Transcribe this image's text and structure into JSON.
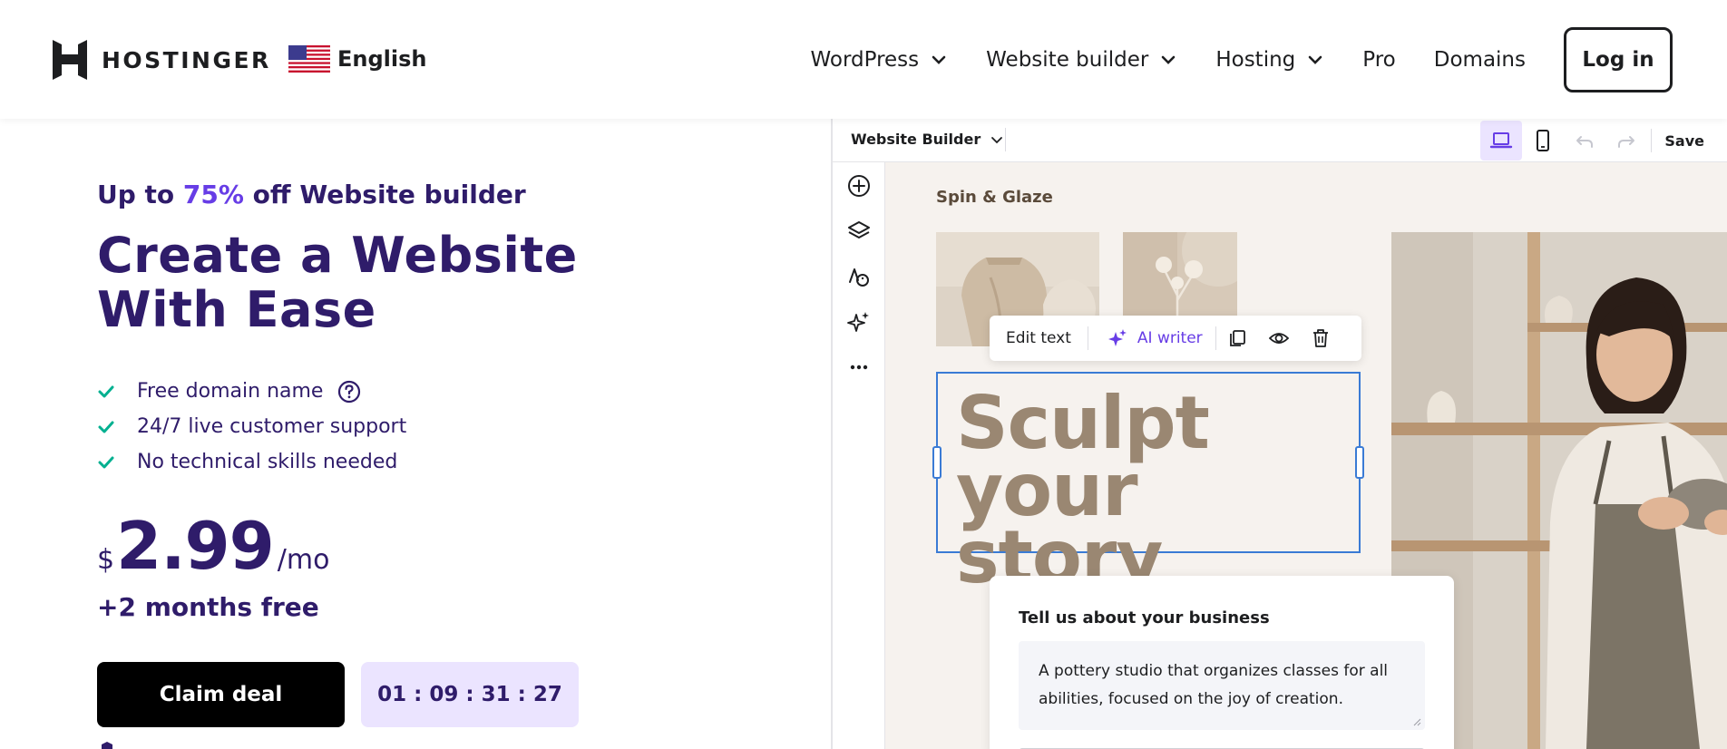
{
  "navbar": {
    "brand": "HOSTINGER",
    "language": "English",
    "links": [
      {
        "label": "WordPress",
        "has_dropdown": true
      },
      {
        "label": "Website builder",
        "has_dropdown": true
      },
      {
        "label": "Hosting",
        "has_dropdown": true
      },
      {
        "label": "Pro",
        "has_dropdown": false
      },
      {
        "label": "Domains",
        "has_dropdown": false
      }
    ],
    "login_label": "Log in"
  },
  "hero": {
    "promo_prefix": "Up to ",
    "promo_accent": "75%",
    "promo_suffix": " off Website builder",
    "headline": "Create a Website With Ease",
    "features": [
      "Free domain name",
      "24/7 live customer support",
      "No technical skills needed"
    ],
    "price": {
      "currency": "$",
      "amount": "2.99",
      "period": "/mo"
    },
    "bonus": "+2 months free",
    "cta_label": "Claim deal",
    "countdown": "01 : 09 : 31 : 27"
  },
  "builder": {
    "title": "Website Builder",
    "save_label": "Save",
    "site_name": "Spin & Glaze",
    "edit_toolbar": {
      "edit_text": "Edit text",
      "ai_writer": "AI writer"
    },
    "heading_line1": "Sculpt",
    "heading_line2": "your story",
    "form": {
      "label": "Tell us about your business",
      "value": "A pottery studio that organizes classes for all abilities, focused on the joy of creation."
    }
  },
  "colors": {
    "brand_purple": "#673de6",
    "text_dark_purple": "#2f1c6a",
    "check_green": "#00b090",
    "cta_black": "#000000",
    "timer_bg": "#ebe4ff",
    "selection_blue": "#3a7bd5",
    "heading_taupe": "#9a8772"
  },
  "icons": {
    "feature_check": "check-icon",
    "feature_help": "question-circle-icon",
    "sidebar": [
      "plus-circle-icon",
      "layers-icon",
      "palette-icon",
      "sparkles-icon",
      "more-dots-icon"
    ]
  }
}
